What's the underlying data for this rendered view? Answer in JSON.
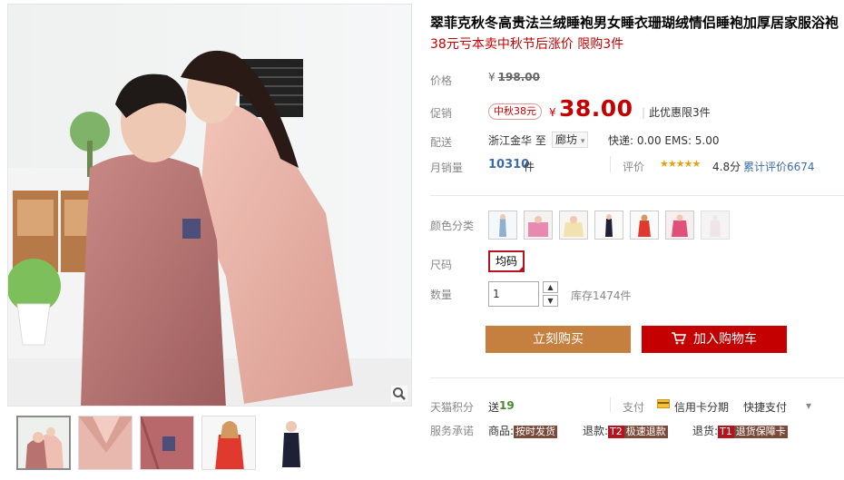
{
  "product": {
    "title": "翠菲克秋冬高贵法兰绒睡袍男女睡衣珊瑚绒情侣睡袍加厚居家服浴袍",
    "subtitle": "38元亏本卖中秋节后涨价 限购3件"
  },
  "price": {
    "label": "价格",
    "currency": "¥",
    "original": "198.00",
    "promo_label": "促销",
    "promo_tag": "中秋38元",
    "promo_value": "38.00",
    "limit_note": "此优惠限3件"
  },
  "shipping": {
    "label": "配送",
    "from": "浙江金华 至",
    "to": "廊坊",
    "fees": "快递: 0.00 EMS: 5.00"
  },
  "sales": {
    "label": "月销量",
    "count": "10310",
    "unit": "件",
    "eval_label": "评价",
    "stars": "★★★★★",
    "rating": "4.8分",
    "total_eval": "累计评价6674"
  },
  "options": {
    "color_label": "颜色分类",
    "size_label": "尺码",
    "size_value": "均码",
    "qty_label": "数量",
    "qty_value": "1",
    "stock": "库存1474件",
    "qty_up": "▲",
    "qty_down": "▼"
  },
  "actions": {
    "buy_now": "立刻购买",
    "add_cart": "加入购物车"
  },
  "footer": {
    "points_label": "天猫积分",
    "points_prefix": "送",
    "points_value": "19",
    "pay_label": "支付",
    "credit": "信用卡分期",
    "quick_pay": "快捷支付",
    "pay_more": "▾",
    "service_label": "服务承诺",
    "goods": "商品:",
    "goods_tag": "按时发货",
    "refund": "退款:",
    "refund_code": "T2",
    "refund_tag": "极速退款",
    "return": "退货:",
    "return_code": "T1",
    "return_tag": "退货保障卡"
  },
  "colors": {
    "accent_red": "#c40000",
    "buy_orange": "#c57f3e",
    "link_blue": "#3c6cab"
  }
}
